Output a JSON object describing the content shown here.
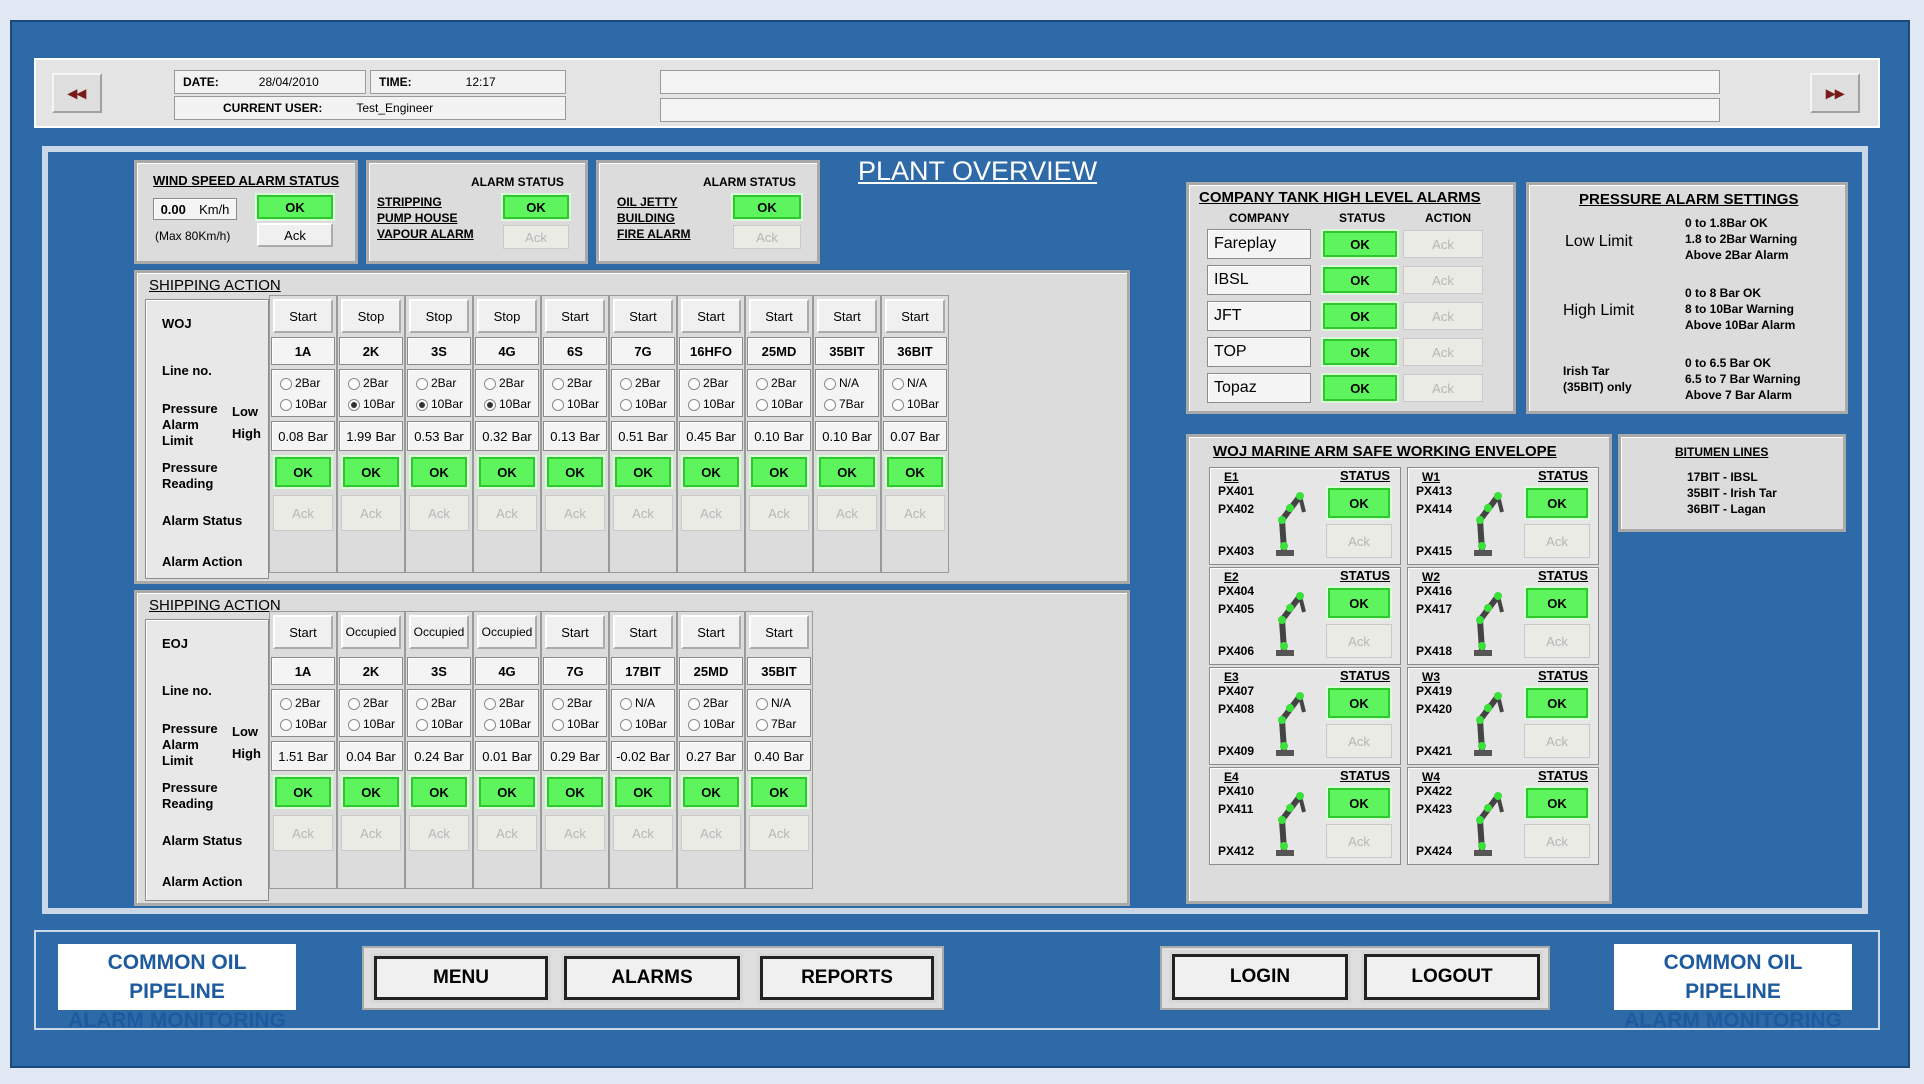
{
  "header": {
    "prev": "◂◂",
    "next": "▸▸",
    "date_label": "DATE:",
    "date": "28/04/2010",
    "time_label": "TIME:",
    "time": "12:17",
    "user_label": "CURRENT USER:",
    "user": "Test_Engineer"
  },
  "title": "PLANT OVERVIEW",
  "wind": {
    "title": "WIND SPEED ALARM STATUS",
    "speed": "0.00",
    "unit": "Km/h",
    "max": "(Max 80Km/h)",
    "ok": "OK",
    "ack": "Ack"
  },
  "stripping": {
    "title": "ALARM STATUS",
    "l1": "STRIPPING",
    "l2": "PUMP HOUSE",
    "l3": "VAPOUR ALARM",
    "ok": "OK",
    "ack": "Ack"
  },
  "jetty": {
    "title": "ALARM STATUS",
    "l1": "OIL JETTY",
    "l2": "BUILDING",
    "l3": "FIRE ALARM",
    "ok": "OK",
    "ack": "Ack"
  },
  "row_labels": {
    "line": "Line no.",
    "pal1": "Pressure",
    "pal2": "Alarm",
    "pal3": "Limit",
    "low": "Low",
    "high": "High",
    "pr1": "Pressure",
    "pr2": "Reading",
    "status": "Alarm Status",
    "action": "Alarm Action"
  },
  "ship1": {
    "title": "SHIPPING ACTION",
    "name": "WOJ",
    "cols": [
      {
        "act": "Start",
        "line": "1A",
        "lo": "2Bar",
        "hi": "10Bar",
        "sel": "",
        "p": "0.08",
        "u": "Bar",
        "ok": "OK",
        "ack": "Ack"
      },
      {
        "act": "Stop",
        "line": "2K",
        "lo": "2Bar",
        "hi": "10Bar",
        "sel": "hi",
        "p": "1.99",
        "u": "Bar",
        "ok": "OK",
        "ack": "Ack"
      },
      {
        "act": "Stop",
        "line": "3S",
        "lo": "2Bar",
        "hi": "10Bar",
        "sel": "hi",
        "p": "0.53",
        "u": "Bar",
        "ok": "OK",
        "ack": "Ack"
      },
      {
        "act": "Stop",
        "line": "4G",
        "lo": "2Bar",
        "hi": "10Bar",
        "sel": "hi",
        "p": "0.32",
        "u": "Bar",
        "ok": "OK",
        "ack": "Ack"
      },
      {
        "act": "Start",
        "line": "6S",
        "lo": "2Bar",
        "hi": "10Bar",
        "sel": "",
        "p": "0.13",
        "u": "Bar",
        "ok": "OK",
        "ack": "Ack"
      },
      {
        "act": "Start",
        "line": "7G",
        "lo": "2Bar",
        "hi": "10Bar",
        "sel": "",
        "p": "0.51",
        "u": "Bar",
        "ok": "OK",
        "ack": "Ack"
      },
      {
        "act": "Start",
        "line": "16HFO",
        "lo": "2Bar",
        "hi": "10Bar",
        "sel": "",
        "p": "0.45",
        "u": "Bar",
        "ok": "OK",
        "ack": "Ack"
      },
      {
        "act": "Start",
        "line": "25MD",
        "lo": "2Bar",
        "hi": "10Bar",
        "sel": "",
        "p": "0.10",
        "u": "Bar",
        "ok": "OK",
        "ack": "Ack"
      },
      {
        "act": "Start",
        "line": "35BIT",
        "lo": "N/A",
        "hi": "7Bar",
        "sel": "",
        "p": "0.10",
        "u": "Bar",
        "ok": "OK",
        "ack": "Ack"
      },
      {
        "act": "Start",
        "line": "36BIT",
        "lo": "N/A",
        "hi": "10Bar",
        "sel": "",
        "p": "0.07",
        "u": "Bar",
        "ok": "OK",
        "ack": "Ack"
      }
    ]
  },
  "ship2": {
    "title": "SHIPPING ACTION",
    "name": "EOJ",
    "cols": [
      {
        "act": "Start",
        "line": "1A",
        "lo": "2Bar",
        "hi": "10Bar",
        "sel": "",
        "p": "1.51",
        "u": "Bar",
        "ok": "OK",
        "ack": "Ack"
      },
      {
        "act": "Occupied",
        "line": "2K",
        "lo": "2Bar",
        "hi": "10Bar",
        "sel": "",
        "p": "0.04",
        "u": "Bar",
        "ok": "OK",
        "ack": "Ack"
      },
      {
        "act": "Occupied",
        "line": "3S",
        "lo": "2Bar",
        "hi": "10Bar",
        "sel": "",
        "p": "0.24",
        "u": "Bar",
        "ok": "OK",
        "ack": "Ack"
      },
      {
        "act": "Occupied",
        "line": "4G",
        "lo": "2Bar",
        "hi": "10Bar",
        "sel": "",
        "p": "0.01",
        "u": "Bar",
        "ok": "OK",
        "ack": "Ack"
      },
      {
        "act": "Start",
        "line": "7G",
        "lo": "2Bar",
        "hi": "10Bar",
        "sel": "",
        "p": "0.29",
        "u": "Bar",
        "ok": "OK",
        "ack": "Ack"
      },
      {
        "act": "Start",
        "line": "17BIT",
        "lo": "N/A",
        "hi": "10Bar",
        "sel": "",
        "p": "-0.02",
        "u": "Bar",
        "ok": "OK",
        "ack": "Ack"
      },
      {
        "act": "Start",
        "line": "25MD",
        "lo": "2Bar",
        "hi": "10Bar",
        "sel": "",
        "p": "0.27",
        "u": "Bar",
        "ok": "OK",
        "ack": "Ack"
      },
      {
        "act": "Start",
        "line": "35BIT",
        "lo": "N/A",
        "hi": "7Bar",
        "sel": "",
        "p": "0.40",
        "u": "Bar",
        "ok": "OK",
        "ack": "Ack"
      }
    ]
  },
  "tanks": {
    "title": "COMPANY TANK HIGH LEVEL ALARMS",
    "h1": "COMPANY",
    "h2": "STATUS",
    "h3": "ACTION",
    "rows": [
      {
        "name": "Fareplay",
        "ok": "OK",
        "ack": "Ack"
      },
      {
        "name": "IBSL",
        "ok": "OK",
        "ack": "Ack"
      },
      {
        "name": "JFT",
        "ok": "OK",
        "ack": "Ack"
      },
      {
        "name": "TOP",
        "ok": "OK",
        "ack": "Ack"
      },
      {
        "name": "Topaz",
        "ok": "OK",
        "ack": "Ack"
      }
    ]
  },
  "pressure": {
    "title": "PRESSURE ALARM SETTINGS",
    "low": "Low Limit",
    "low_t": [
      "0 to 1.8Bar OK",
      "1.8 to 2Bar Warning",
      "Above 2Bar Alarm"
    ],
    "high": "High Limit",
    "high_t": [
      "0 to 8 Bar OK",
      "8 to 10Bar Warning",
      "Above 10Bar Alarm"
    ],
    "it1": "Irish Tar",
    "it2": "(35BIT) only",
    "it_t": [
      "0 to 6.5 Bar OK",
      "6.5 to 7 Bar Warning",
      "Above 7 Bar Alarm"
    ]
  },
  "envelope": {
    "title": "WOJ MARINE ARM SAFE WORKING ENVELOPE",
    "arms": [
      {
        "id": "E1",
        "px": [
          "PX401",
          "PX402",
          "PX403"
        ],
        "st": "STATUS",
        "ok": "OK",
        "ack": "Ack"
      },
      {
        "id": "W1",
        "px": [
          "PX413",
          "PX414",
          "PX415"
        ],
        "st": "STATUS",
        "ok": "OK",
        "ack": "Ack"
      },
      {
        "id": "E2",
        "px": [
          "PX404",
          "PX405",
          "PX406"
        ],
        "st": "STATUS",
        "ok": "OK",
        "ack": "Ack"
      },
      {
        "id": "W2",
        "px": [
          "PX416",
          "PX417",
          "PX418"
        ],
        "st": "STATUS",
        "ok": "OK",
        "ack": "Ack"
      },
      {
        "id": "E3",
        "px": [
          "PX407",
          "PX408",
          "PX409"
        ],
        "st": "STATUS",
        "ok": "OK",
        "ack": "Ack"
      },
      {
        "id": "W3",
        "px": [
          "PX419",
          "PX420",
          "PX421"
        ],
        "st": "STATUS",
        "ok": "OK",
        "ack": "Ack"
      },
      {
        "id": "E4",
        "px": [
          "PX410",
          "PX411",
          "PX412"
        ],
        "st": "STATUS",
        "ok": "OK",
        "ack": "Ack"
      },
      {
        "id": "W4",
        "px": [
          "PX422",
          "PX423",
          "PX424"
        ],
        "st": "STATUS",
        "ok": "OK",
        "ack": "Ack"
      }
    ]
  },
  "bitumen": {
    "title": "BITUMEN LINES",
    "lines": [
      "17BIT - IBSL",
      "35BIT - Irish Tar",
      "36BIT - Lagan"
    ]
  },
  "footer": {
    "brand1": "COMMON OIL PIPELINE",
    "brand2": "ALARM MONITORING",
    "menu": "MENU",
    "alarms": "ALARMS",
    "reports": "REPORTS",
    "login": "LOGIN",
    "logout": "LOGOUT"
  },
  "colors": {
    "background": "#2f6aa8",
    "ok": "#5ef45e",
    "panel": "#dcdcdc",
    "brand_text": "#1d5a9e"
  }
}
